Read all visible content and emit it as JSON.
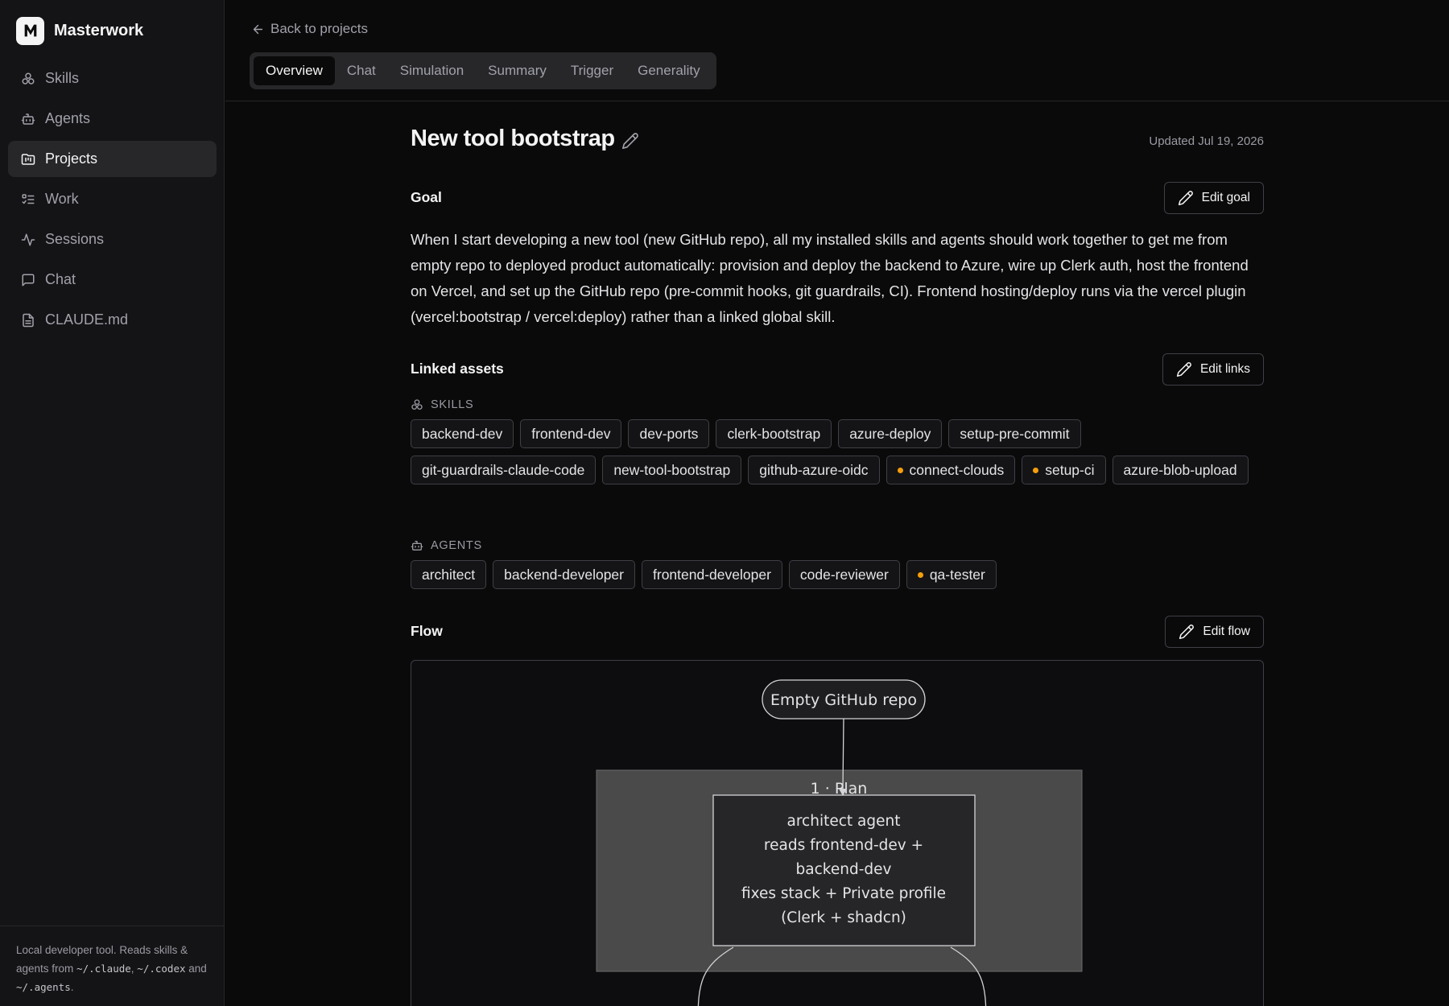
{
  "app": {
    "name": "Masterwork"
  },
  "sidebar": {
    "items": [
      {
        "label": "Skills",
        "icon": "skills-icon",
        "active": false
      },
      {
        "label": "Agents",
        "icon": "bot-icon",
        "active": false
      },
      {
        "label": "Projects",
        "icon": "projects-icon",
        "active": true
      },
      {
        "label": "Work",
        "icon": "list-checks-icon",
        "active": false
      },
      {
        "label": "Sessions",
        "icon": "activity-icon",
        "active": false
      },
      {
        "label": "Chat",
        "icon": "message-icon",
        "active": false
      },
      {
        "label": "CLAUDE.md",
        "icon": "file-icon",
        "active": false
      }
    ],
    "footer": {
      "text1": "Local developer tool. Reads skills & agents from ",
      "path1": "~/.claude",
      "sep1": ", ",
      "path2": "~/.codex",
      "text2": " and ",
      "path3": "~/.agents",
      "text3": "."
    }
  },
  "header": {
    "back_label": "Back to projects",
    "tabs": [
      "Overview",
      "Chat",
      "Simulation",
      "Summary",
      "Trigger",
      "Generality"
    ],
    "active_tab": "Overview"
  },
  "project": {
    "title": "New tool bootstrap",
    "updated": "Updated Jul 19, 2026"
  },
  "goal": {
    "heading": "Goal",
    "button": "Edit goal",
    "text": "When I start developing a new tool (new GitHub repo), all my installed skills and agents should work together to get me from empty repo to deployed product automatically: provision and deploy the backend to Azure, wire up Clerk auth, host the frontend on Vercel, and set up the GitHub repo (pre-commit hooks, git guardrails, CI). Frontend hosting/deploy runs via the vercel plugin (vercel:bootstrap / vercel:deploy) rather than a linked global skill."
  },
  "linked": {
    "heading": "Linked assets",
    "button": "Edit links",
    "skills_label": "SKILLS",
    "skills": [
      {
        "name": "backend-dev",
        "dot": false
      },
      {
        "name": "frontend-dev",
        "dot": false
      },
      {
        "name": "dev-ports",
        "dot": false
      },
      {
        "name": "clerk-bootstrap",
        "dot": false
      },
      {
        "name": "azure-deploy",
        "dot": false
      },
      {
        "name": "setup-pre-commit",
        "dot": false
      },
      {
        "name": "git-guardrails-claude-code",
        "dot": false
      },
      {
        "name": "new-tool-bootstrap",
        "dot": false
      },
      {
        "name": "github-azure-oidc",
        "dot": false
      },
      {
        "name": "connect-clouds",
        "dot": true
      },
      {
        "name": "setup-ci",
        "dot": true
      },
      {
        "name": "azure-blob-upload",
        "dot": false
      }
    ],
    "agents_label": "AGENTS",
    "agents": [
      {
        "name": "architect",
        "dot": false
      },
      {
        "name": "backend-developer",
        "dot": false
      },
      {
        "name": "frontend-developer",
        "dot": false
      },
      {
        "name": "code-reviewer",
        "dot": false
      },
      {
        "name": "qa-tester",
        "dot": true
      }
    ]
  },
  "flow": {
    "heading": "Flow",
    "button": "Edit flow",
    "start_node": "Empty GitHub repo",
    "step_label": "1 · Plan",
    "step_lines": [
      "architect agent",
      "reads frontend-dev +",
      "backend-dev",
      "fixes stack + Private profile",
      "(Clerk + shadcn)"
    ]
  }
}
